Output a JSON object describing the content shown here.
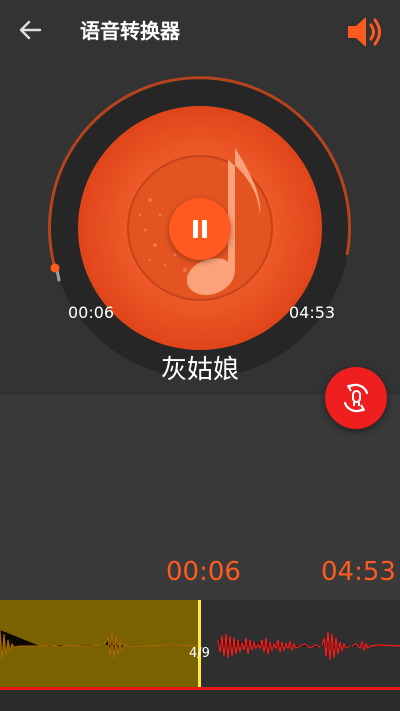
{
  "header": {
    "back_icon": "arrow-left-icon",
    "title": "语音转换器",
    "volume_icon": "volume-icon"
  },
  "player": {
    "song_title": "灰姑娘",
    "current_time": "00:06",
    "total_time": "04:53",
    "progress": 0.02,
    "pause_icon": "pause-icon",
    "fab_icon": "voice-changer-icon",
    "accent_color": "#ff5a1f",
    "fab_color": "#f01f1f"
  },
  "timeline": {
    "current_time": "00:06",
    "total_time": "04:53"
  },
  "waveform": {
    "page_label": "4/9",
    "played_color": "#7a6200",
    "wave_color": "#ff1a1a"
  }
}
